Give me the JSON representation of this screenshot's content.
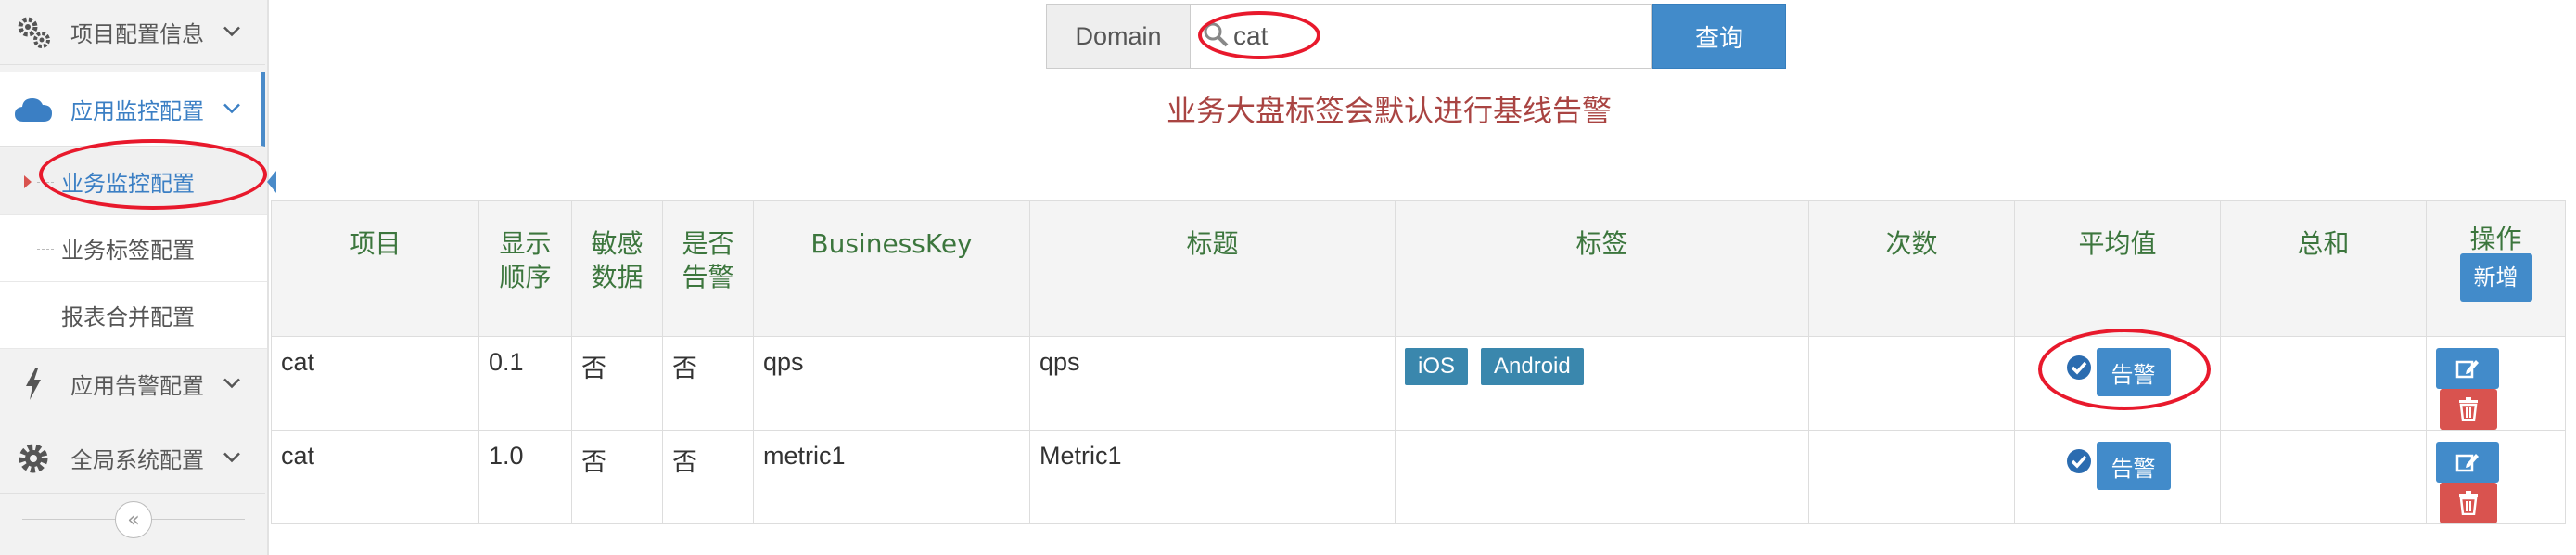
{
  "sidebar": {
    "items": [
      {
        "label": "项目配置信息",
        "icon": "gears-icon"
      },
      {
        "label": "应用监控配置",
        "icon": "cloud-icon"
      },
      {
        "label": "应用告警配置",
        "icon": "bolt-icon"
      },
      {
        "label": "全局系统配置",
        "icon": "gear-icon"
      }
    ],
    "sub_items": [
      {
        "label": "业务监控配置"
      },
      {
        "label": "业务标签配置"
      },
      {
        "label": "报表合并配置"
      }
    ],
    "collapse_glyph": "«"
  },
  "search": {
    "addon_label": "Domain",
    "value": "cat",
    "button_label": "查询"
  },
  "notice": "业务大盘标签会默认进行基线告警",
  "table": {
    "headers": {
      "project": "项目",
      "order": "显示顺序",
      "sensitive": "敏感数据",
      "alert": "是否告警",
      "key": "BusinessKey",
      "title": "标题",
      "tags": "标签",
      "count": "次数",
      "avg": "平均值",
      "sum": "总和",
      "ops": "操作",
      "add_button": "新增"
    },
    "rows": [
      {
        "project": "cat",
        "order": "0.1",
        "sensitive": "否",
        "alert": "否",
        "key": "qps",
        "title": "qps",
        "tag1": "iOS",
        "tag2": "Android",
        "count": "",
        "avg_button": "告警",
        "sum": ""
      },
      {
        "project": "cat",
        "order": "1.0",
        "sensitive": "否",
        "alert": "否",
        "key": "metric1",
        "title": "Metric1",
        "count": "",
        "avg_button": "告警",
        "sum": ""
      }
    ]
  },
  "colors": {
    "primary": "#428bca",
    "danger": "#d9534f",
    "header_text": "#3c763d",
    "notice": "#a94442",
    "annotation": "#e8192c"
  }
}
